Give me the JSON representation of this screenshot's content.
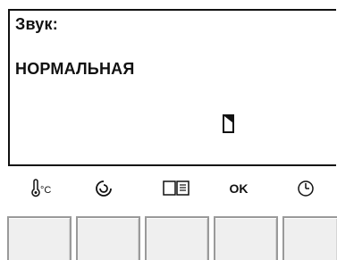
{
  "display": {
    "title": "Звук:",
    "value": "НОРМАЛЬНАЯ"
  },
  "icons": {
    "temp_text": "°C",
    "ok_label": "OK"
  }
}
